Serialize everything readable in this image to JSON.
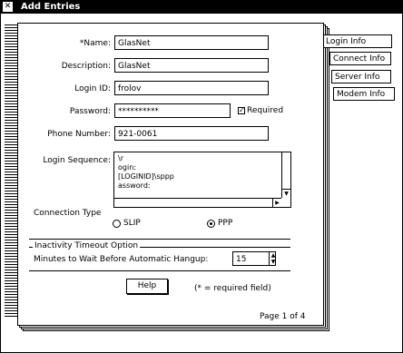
{
  "window": {
    "title": "Add Entries",
    "system_menu_icon": "system-menu-icon"
  },
  "tabs": [
    {
      "label": "Login Info",
      "active": true
    },
    {
      "label": "Connect Info",
      "active": false
    },
    {
      "label": "Server Info",
      "active": false
    },
    {
      "label": "Modem Info",
      "active": false
    }
  ],
  "form": {
    "name_label": "*Name:",
    "name_value": "GlasNet",
    "description_label": "Description:",
    "description_value": "GlasNet",
    "login_id_label": "Login ID:",
    "login_id_value": "frolov",
    "password_label": "Password:",
    "password_value": "**********",
    "required_label": "Required",
    "required_checked": true,
    "phone_label": "Phone Number:",
    "phone_value": "921-0061",
    "login_sequence_label": "Login Sequence:",
    "login_sequence_lines": [
      "\\r",
      "ogin:",
      "[LOGINID]\\sppp",
      "assword:",
      ""
    ],
    "connection_type_label": "Connection Type",
    "slip_label": "SLIP",
    "ppp_label": "PPP",
    "selected_connection": "PPP",
    "inactivity_group_label": "Inactivity Timeout Option",
    "minutes_label": "Minutes to Wait Before Automatic Hangup:",
    "minutes_value": "15",
    "help_button": "Help",
    "required_note": "(* = required field)",
    "page_indicator": "Page 1 of 4"
  }
}
